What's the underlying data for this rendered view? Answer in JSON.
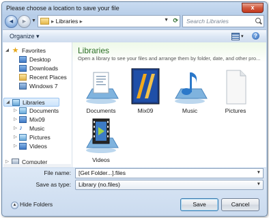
{
  "window": {
    "title": "Please choose a location to save your file",
    "close_label": "x"
  },
  "address": {
    "path": "Libraries",
    "separator": "▸",
    "search_placeholder": "Search Libraries"
  },
  "toolbar": {
    "organize_label": "Organize ▾"
  },
  "nav": {
    "favorites_label": "Favorites",
    "favorites": [
      "Desktop",
      "Downloads",
      "Recent Places",
      "Windows 7"
    ],
    "libraries_label": "Libraries",
    "libraries": [
      "Documents",
      "Mix09",
      "Music",
      "Pictures",
      "Videos"
    ],
    "computer_label": "Computer"
  },
  "content": {
    "title": "Libraries",
    "subtitle": "Open a library to see your files and arrange them by folder, date, and other pro...",
    "items": [
      {
        "label": "Documents",
        "icon": "documents-library-icon"
      },
      {
        "label": "Mix09",
        "icon": "mix09-library-icon"
      },
      {
        "label": "Music",
        "icon": "music-library-icon"
      },
      {
        "label": "Pictures",
        "icon": "pictures-library-icon"
      },
      {
        "label": "Videos",
        "icon": "videos-library-icon"
      }
    ]
  },
  "footer": {
    "filename_label": "File name:",
    "filename_value": "[Get Folder...].files",
    "savetype_label": "Save as type:",
    "savetype_value": "Library (no.files)",
    "hide_folders_label": "Hide Folders",
    "save_label": "Save",
    "cancel_label": "Cancel"
  }
}
